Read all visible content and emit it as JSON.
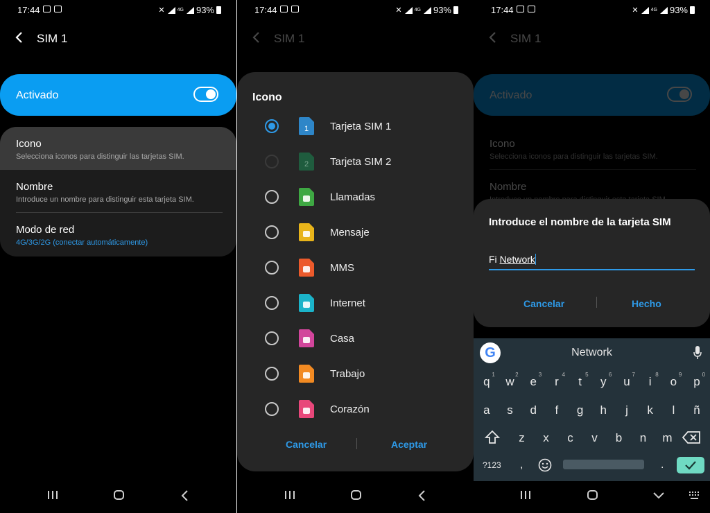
{
  "status": {
    "time": "17:44",
    "net": "4G",
    "battery": "93%"
  },
  "screen1": {
    "title": "SIM 1",
    "activado": {
      "label": "Activado",
      "on": true
    },
    "rows": [
      {
        "title": "Icono",
        "subtitle": "Selecciona iconos para distinguir las tarjetas SIM."
      },
      {
        "title": "Nombre",
        "subtitle": "Introduce un nombre para distinguir esta tarjeta SIM."
      },
      {
        "title": "Modo de red",
        "subtitle": "4G/3G/2G (conectar automáticamente)"
      }
    ]
  },
  "screen2": {
    "dialog_title": "Icono",
    "options": [
      {
        "label": "Tarjeta SIM 1",
        "icon": "sim-1-icon",
        "badge": "1",
        "color": "#2e86c8",
        "selected": true,
        "enabled": true
      },
      {
        "label": "Tarjeta SIM 2",
        "icon": "sim-2-icon",
        "badge": "2",
        "color": "#1f5c3e",
        "selected": false,
        "enabled": false
      },
      {
        "label": "Llamadas",
        "icon": "phone-icon",
        "badge": "",
        "color": "#3ea843",
        "selected": false,
        "enabled": true
      },
      {
        "label": "Mensaje",
        "icon": "message-icon",
        "badge": "",
        "color": "#e8b41a",
        "selected": false,
        "enabled": true
      },
      {
        "label": "MMS",
        "icon": "mms-icon",
        "badge": "",
        "color": "#ec5a2b",
        "selected": false,
        "enabled": true
      },
      {
        "label": "Internet",
        "icon": "globe-icon",
        "badge": "",
        "color": "#1bb3c9",
        "selected": false,
        "enabled": true
      },
      {
        "label": "Casa",
        "icon": "home-icon",
        "badge": "",
        "color": "#d2459b",
        "selected": false,
        "enabled": true
      },
      {
        "label": "Trabajo",
        "icon": "work-icon",
        "badge": "",
        "color": "#f28a22",
        "selected": false,
        "enabled": true
      },
      {
        "label": "Corazón",
        "icon": "heart-icon",
        "badge": "",
        "color": "#e8477a",
        "selected": false,
        "enabled": true
      }
    ],
    "cancel": "Cancelar",
    "accept": "Aceptar"
  },
  "screen3": {
    "dialog_title": "Introduce el nombre de la tarjeta SIM",
    "input_prefix": "Fi ",
    "input_word": "Network",
    "cancel": "Cancelar",
    "done": "Hecho",
    "keyboard": {
      "suggestion": "Network",
      "row1": [
        "q",
        "w",
        "e",
        "r",
        "t",
        "y",
        "u",
        "i",
        "o",
        "p"
      ],
      "row1_hints": [
        "1",
        "2",
        "3",
        "4",
        "5",
        "6",
        "7",
        "8",
        "9",
        "0"
      ],
      "row2": [
        "a",
        "s",
        "d",
        "f",
        "g",
        "h",
        "j",
        "k",
        "l",
        "ñ"
      ],
      "row3": [
        "z",
        "x",
        "c",
        "v",
        "b",
        "n",
        "m"
      ],
      "symbols": "?123",
      "comma": ",",
      "period": "."
    }
  },
  "colors": {
    "accent": "#0a9df2",
    "link": "#2e9ae8",
    "dialog": "#262626",
    "keyboard": "#24323a",
    "enter": "#6fdac3"
  }
}
